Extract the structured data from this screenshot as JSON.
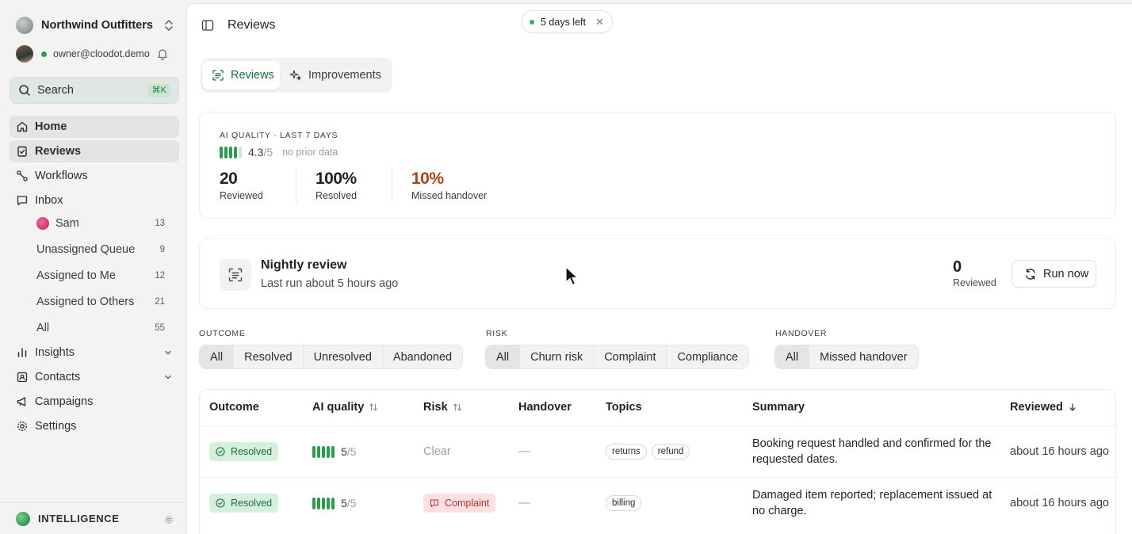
{
  "colors": {
    "accent": "#2f9b4f",
    "warn": "#a6451a",
    "danger": "#b0302f"
  },
  "sidebar": {
    "org_name": "Northwind Outfitters",
    "user_email": "owner@cloodot.demo",
    "search_label": "Search",
    "search_shortcut": "⌘K",
    "nav": {
      "home": "Home",
      "reviews": "Reviews",
      "workflows": "Workflows",
      "inbox": "Inbox",
      "insights": "Insights",
      "contacts": "Contacts",
      "campaigns": "Campaigns",
      "settings": "Settings"
    },
    "inbox_items": [
      {
        "label": "Sam",
        "count": "13"
      },
      {
        "label": "Unassigned Queue",
        "count": "9"
      },
      {
        "label": "Assigned to Me",
        "count": "12"
      },
      {
        "label": "Assigned to Others",
        "count": "21"
      },
      {
        "label": "All",
        "count": "55"
      }
    ],
    "footer_label": "INTELLIGENCE"
  },
  "header": {
    "title": "Reviews",
    "trial_label": "5 days left"
  },
  "tabs": [
    "Reviews",
    "Improvements"
  ],
  "quality": {
    "kicker": "AI QUALITY · LAST 7 DAYS",
    "score": "4.3",
    "score_den": "/5",
    "score_value": 4.3,
    "no_prior": "no prior data",
    "stats": [
      {
        "value": "20",
        "label": "Reviewed"
      },
      {
        "value": "100%",
        "label": "Resolved"
      },
      {
        "value": "10%",
        "label": "Missed handover"
      }
    ]
  },
  "nightly": {
    "title": "Nightly review",
    "subtitle": "Last run about 5 hours ago",
    "count": "0",
    "count_label": "Reviewed",
    "run_label": "Run now"
  },
  "filters": {
    "outcome": {
      "label": "OUTCOME",
      "options": [
        "All",
        "Resolved",
        "Unresolved",
        "Abandoned"
      ],
      "selected": 0
    },
    "risk": {
      "label": "RISK",
      "options": [
        "All",
        "Churn risk",
        "Complaint",
        "Compliance"
      ],
      "selected": 0
    },
    "handover": {
      "label": "HANDOVER",
      "options": [
        "All",
        "Missed handover"
      ],
      "selected": 0
    }
  },
  "table": {
    "columns": [
      "Outcome",
      "AI quality",
      "Risk",
      "Handover",
      "Topics",
      "Summary",
      "Reviewed"
    ],
    "rows": [
      {
        "outcome": "Resolved",
        "quality": "5",
        "quality_den": "/5",
        "risk": "Clear",
        "handover": "—",
        "topics": [
          "returns",
          "refund"
        ],
        "summary": "Booking request handled and confirmed for the requested dates.",
        "reviewed": "about 16 hours ago"
      },
      {
        "outcome": "Resolved",
        "quality": "5",
        "quality_den": "/5",
        "risk": "Complaint",
        "handover": "—",
        "topics": [
          "billing"
        ],
        "summary": "Damaged item reported; replacement issued at no charge.",
        "reviewed": "about 16 hours ago"
      }
    ]
  }
}
